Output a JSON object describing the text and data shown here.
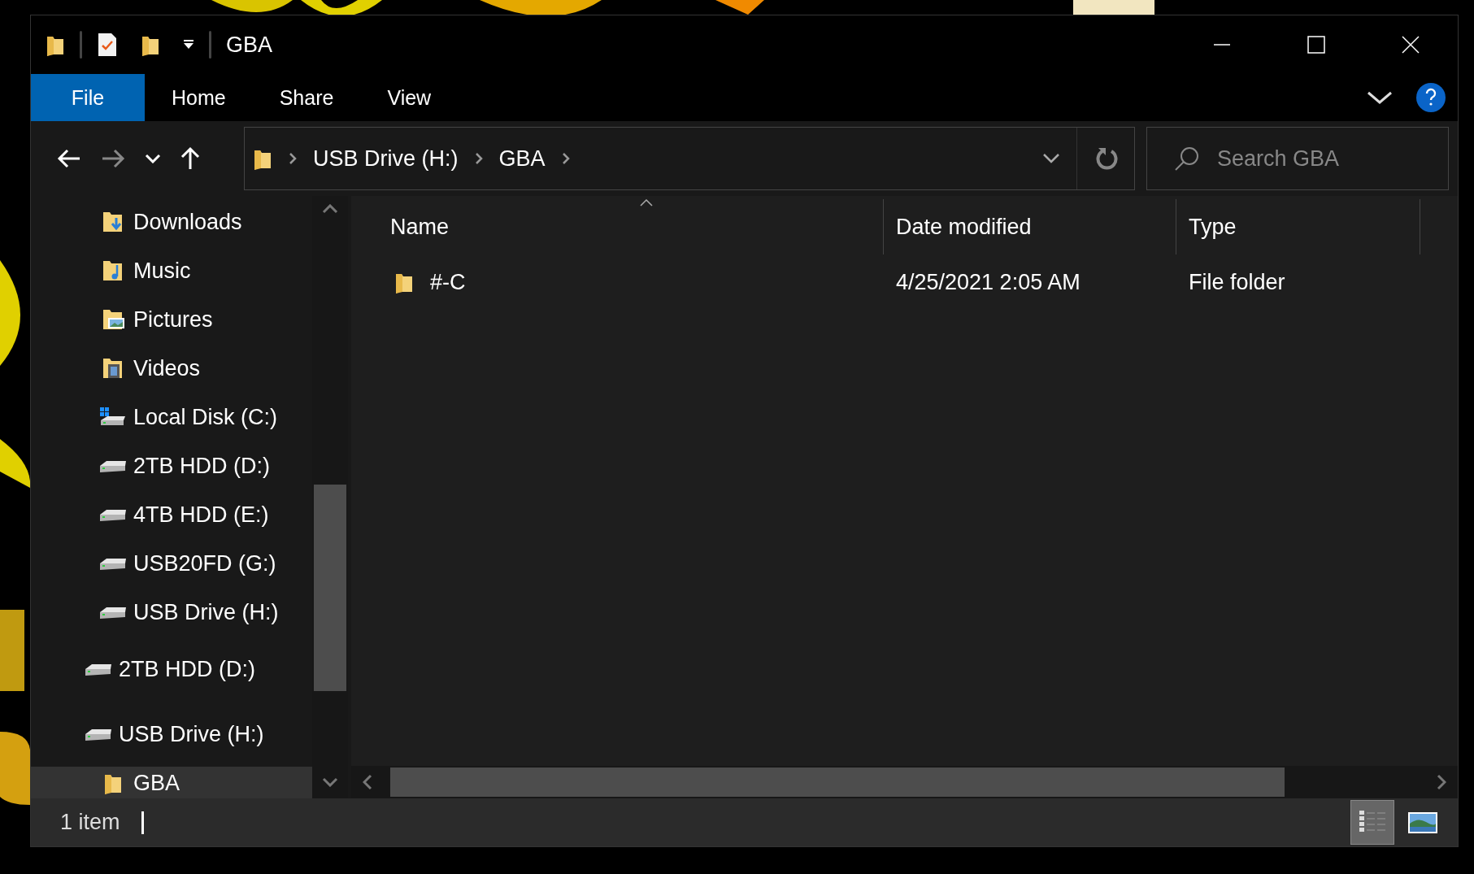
{
  "window": {
    "title": "GBA"
  },
  "ribbon": {
    "tabs": [
      {
        "label": "File",
        "kind": "menu"
      },
      {
        "label": "Home",
        "kind": "tab"
      },
      {
        "label": "Share",
        "kind": "tab"
      },
      {
        "label": "View",
        "kind": "tab"
      }
    ]
  },
  "address_bar": {
    "path": [
      "USB Drive (H:)",
      "GBA"
    ]
  },
  "search": {
    "placeholder": "Search GBA"
  },
  "navigation_pane": {
    "items": [
      {
        "label": "Downloads",
        "kind": "downloads",
        "selected": false
      },
      {
        "label": "Music",
        "kind": "music",
        "selected": false
      },
      {
        "label": "Pictures",
        "kind": "pictures",
        "selected": false
      },
      {
        "label": "Videos",
        "kind": "videos",
        "selected": false
      },
      {
        "label": "Local Disk (C:)",
        "kind": "system-drive",
        "selected": false
      },
      {
        "label": "2TB HDD (D:)",
        "kind": "drive",
        "selected": false
      },
      {
        "label": "4TB HDD (E:)",
        "kind": "drive",
        "selected": false
      },
      {
        "label": "USB20FD (G:)",
        "kind": "drive",
        "selected": false
      },
      {
        "label": "USB Drive (H:)",
        "kind": "drive",
        "selected": false
      }
    ],
    "drives": [
      {
        "label": "2TB HDD (D:)",
        "kind": "drive",
        "selected": false
      },
      {
        "label": "USB Drive (H:)",
        "kind": "drive",
        "selected": false,
        "children": [
          {
            "label": "GBA",
            "kind": "folder",
            "selected": true
          }
        ]
      }
    ]
  },
  "file_list": {
    "columns": [
      {
        "label": "Name",
        "sorted": true
      },
      {
        "label": "Date modified",
        "sorted": false
      },
      {
        "label": "Type",
        "sorted": false
      }
    ],
    "rows": [
      {
        "name": "#-C",
        "date_modified": "4/25/2021 2:05 AM",
        "type": "File folder",
        "selected": false
      }
    ]
  },
  "status_bar": {
    "item_count": "1 item",
    "views": [
      {
        "kind": "details",
        "selected": true
      },
      {
        "kind": "large-icons",
        "selected": false
      }
    ]
  }
}
